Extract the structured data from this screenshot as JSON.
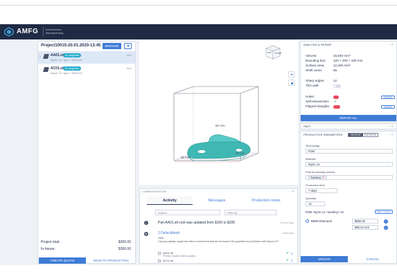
{
  "brand": {
    "name": "AMFG",
    "subtitle": "Autonomous Manufacturing"
  },
  "project": {
    "title": "Project10015-20.01.2020-13:45",
    "browse_label": "BROWSE",
    "parts": [
      {
        "name": "AA01.stl",
        "status": "In progress",
        "detail": "Nylon 12 / qty 1 / $200.00",
        "unit": "mm",
        "selected": true
      },
      {
        "name": "AC01.stl",
        "status": "In progress",
        "detail": "Nylon 12 / qty 1 / $100.00",
        "unit": "mm",
        "selected": false
      }
    ],
    "totals": [
      {
        "label": "Project total:",
        "value": "$300.00"
      },
      {
        "label": "In-house:",
        "value": "$300.00"
      }
    ],
    "create_label": "CREATE QUOTE",
    "send_label": "SEND TO PRODUCTION"
  },
  "viewer": {
    "cube_left": "Left",
    "cube_front": "Front",
    "dim_height": "60 mm",
    "dim_width": "60 mm",
    "dim_depth": "60 mm"
  },
  "communication": {
    "header": "COMMUNICATION",
    "tabs": [
      "Activity",
      "Messages",
      "Production notes"
    ],
    "search_placeholder": "Search",
    "filter_placeholder": "Filter by",
    "activity": {
      "text": "Part AA01.stl cost was updated from $100 to $200",
      "time": "2 hours ago"
    },
    "message": {
      "author": "3 Delia Abbott",
      "time": "Yesterday",
      "greeting": "Hello",
      "body": "Can you please quote two files in short term and let me know if it's possible to print them with Nylon 12?",
      "attachments": [
        {
          "name": "AA01.stl",
          "note": "Please double check quality"
        },
        {
          "name": "AC01.stl",
          "note": ""
        }
      ]
    }
  },
  "analysis": {
    "header": "ANALYSIS & REPAIR",
    "stats": [
      {
        "label": "Volume:",
        "value": "16,840 mm³"
      },
      {
        "label": "Bounding box:",
        "value": "120 × 200 × 160 mm"
      },
      {
        "label": "Surface area:",
        "value": "12,400 mm²"
      },
      {
        "label": "Shell count:",
        "value": "68"
      }
    ],
    "sharp_edges_label": "Sharp edges:",
    "sharp_edges_value": "12",
    "thin_wall_label": "Thin wall:",
    "holes_label": "Holes:",
    "holes_value": "0",
    "self_intersection_label": "Self-intersection:",
    "flipped_label": "Flipped triangles:",
    "flipped_value": "70",
    "repair_label": "REPAIR",
    "repair_all_label": "REPAIR ALL"
  },
  "part_panel": {
    "header": "PART"
  },
  "production": {
    "header": "PRODUCTION PARAMETERS",
    "toggle_a": "INHOUSE",
    "toggle_b": "PARTNERS",
    "technology_label": "Technology:",
    "technology_value": "FDM",
    "material_label": "Material:",
    "material_value": "Nylon 12",
    "post_label": "Post processing service:",
    "post_chip": "Sanding",
    "time_label": "Production time:",
    "time_value": "7 days",
    "quantity_label": "Quantity:",
    "quantity_value": "10",
    "summary": "FDM, Nylon 12 / Sanding / 10",
    "save_label": "SAVE CONFIG",
    "supplier_name": "BMW Eisenach",
    "price_total": "$850.00",
    "price_unit": "$85.04 unit",
    "update_label": "UPDATE",
    "cancel_label": "CANCEL"
  },
  "colors": {
    "accent": "#3d7bd6",
    "header_bg": "#1f2a44",
    "part_color": "#3fb8b4",
    "badge": "#27aecd"
  }
}
